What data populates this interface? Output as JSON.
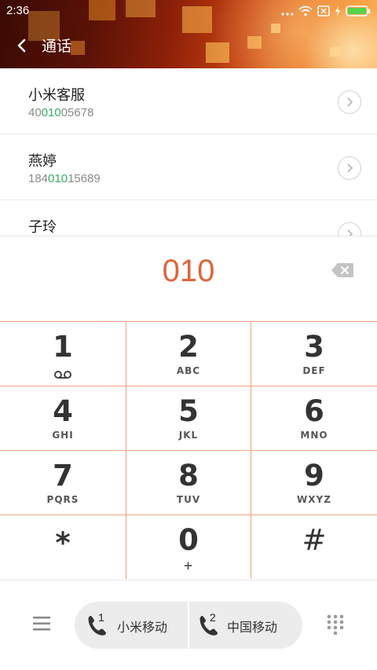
{
  "status": {
    "time": "2:36"
  },
  "header": {
    "title": "通话"
  },
  "contacts": [
    {
      "name": "小米客服",
      "num_pre": "40",
      "num_hl": "010",
      "num_post": "05678"
    },
    {
      "name": "燕婷",
      "num_pre": "184",
      "num_hl": "010",
      "num_post": "15689"
    },
    {
      "name": "子玲",
      "num_pre": "",
      "num_hl": "",
      "num_post": ""
    }
  ],
  "display": {
    "digits": "010"
  },
  "keys": [
    {
      "digit": "1",
      "letters": ""
    },
    {
      "digit": "2",
      "letters": "ABC"
    },
    {
      "digit": "3",
      "letters": "DEF"
    },
    {
      "digit": "4",
      "letters": "GHI"
    },
    {
      "digit": "5",
      "letters": "JKL"
    },
    {
      "digit": "6",
      "letters": "MNO"
    },
    {
      "digit": "7",
      "letters": "PQRS"
    },
    {
      "digit": "8",
      "letters": "TUV"
    },
    {
      "digit": "9",
      "letters": "WXYZ"
    },
    {
      "digit": "*",
      "letters": ""
    },
    {
      "digit": "0",
      "letters": "+"
    },
    {
      "digit": "#",
      "letters": ""
    }
  ],
  "bottom": {
    "sim1": {
      "number": "1",
      "label": "小米移动"
    },
    "sim2": {
      "number": "2",
      "label": "中国移动"
    }
  },
  "colors": {
    "accent": "#e0643a",
    "highlight": "#2fae61",
    "keyline": "#f0a27e"
  },
  "icons": [
    "back-arrow-icon",
    "wifi-icon",
    "sim-x-icon",
    "charging-icon",
    "battery-icon",
    "chevron-right-icon",
    "backspace-icon",
    "voicemail-icon",
    "menu-icon",
    "phone-icon",
    "dialpad-icon"
  ]
}
